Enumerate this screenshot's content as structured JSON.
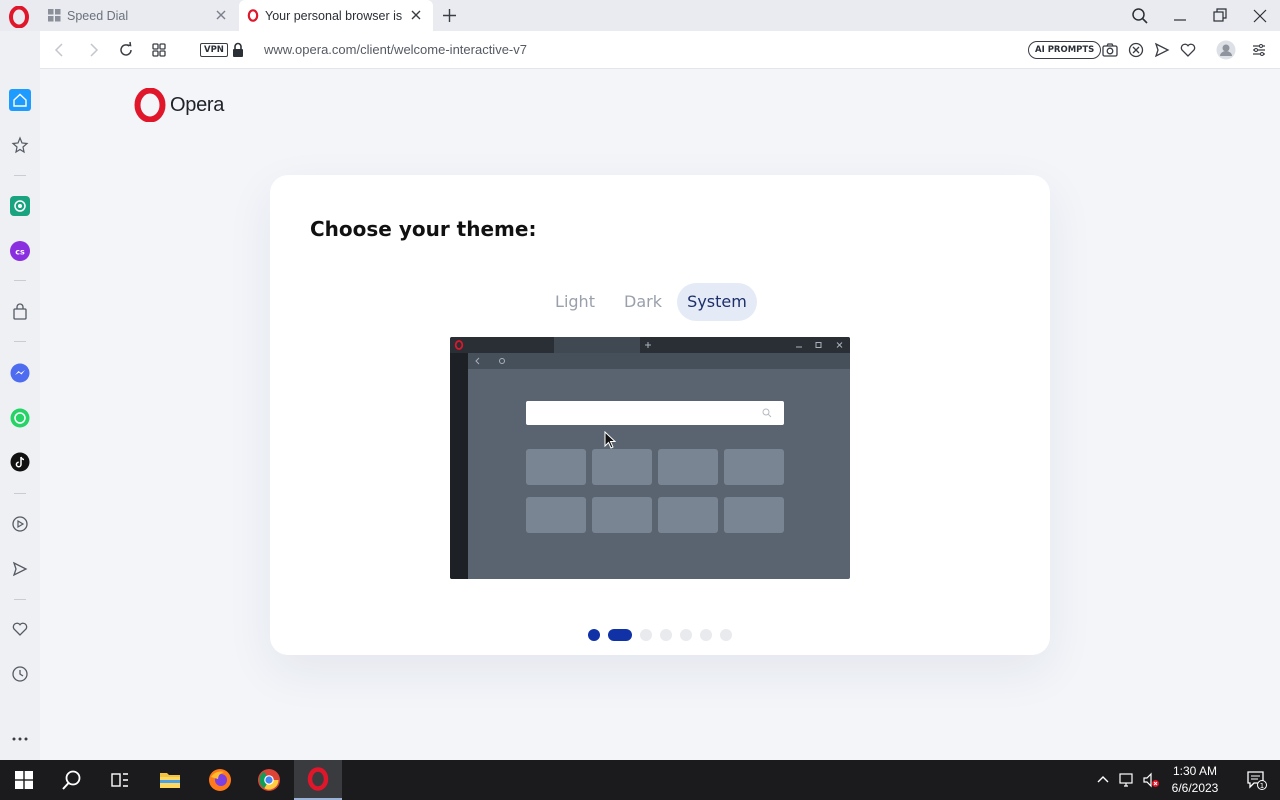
{
  "tabs": [
    {
      "label": "Speed Dial",
      "icon": "speed-dial-icon"
    },
    {
      "label": "Your personal browser is a",
      "icon": "opera-icon"
    }
  ],
  "address": {
    "vpn_label": "VPN",
    "url": "www.opera.com/client/welcome-interactive-v7",
    "ai_prompts_label": "AI PROMPTS"
  },
  "page": {
    "logo_text": "Opera",
    "title": "Choose your theme:",
    "theme_options": [
      {
        "label": "Light",
        "selected": false
      },
      {
        "label": "Dark",
        "selected": false
      },
      {
        "label": "System",
        "selected": true
      }
    ],
    "steps": {
      "total": 7,
      "current": 2
    }
  },
  "taskbar": {
    "time": "1:30 AM",
    "date": "6/6/2023",
    "notification_count": "1"
  },
  "colors": {
    "accent": "#1032a6",
    "opera_red": "#e0162b",
    "selected_pill": "#e4ebf6"
  }
}
